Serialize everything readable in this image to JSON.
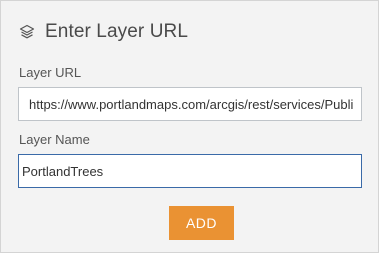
{
  "dialog": {
    "title": "Enter Layer URL",
    "title_icon": "layers-icon",
    "accent_color": "#ea9233",
    "focus_border_color": "#3a6aa8"
  },
  "fields": {
    "url": {
      "label": "Layer URL",
      "value": "https://www.portlandmaps.com/arcgis/rest/services/Public"
    },
    "name": {
      "label": "Layer Name",
      "value": "PortlandTrees"
    }
  },
  "actions": {
    "add_label": "ADD"
  }
}
